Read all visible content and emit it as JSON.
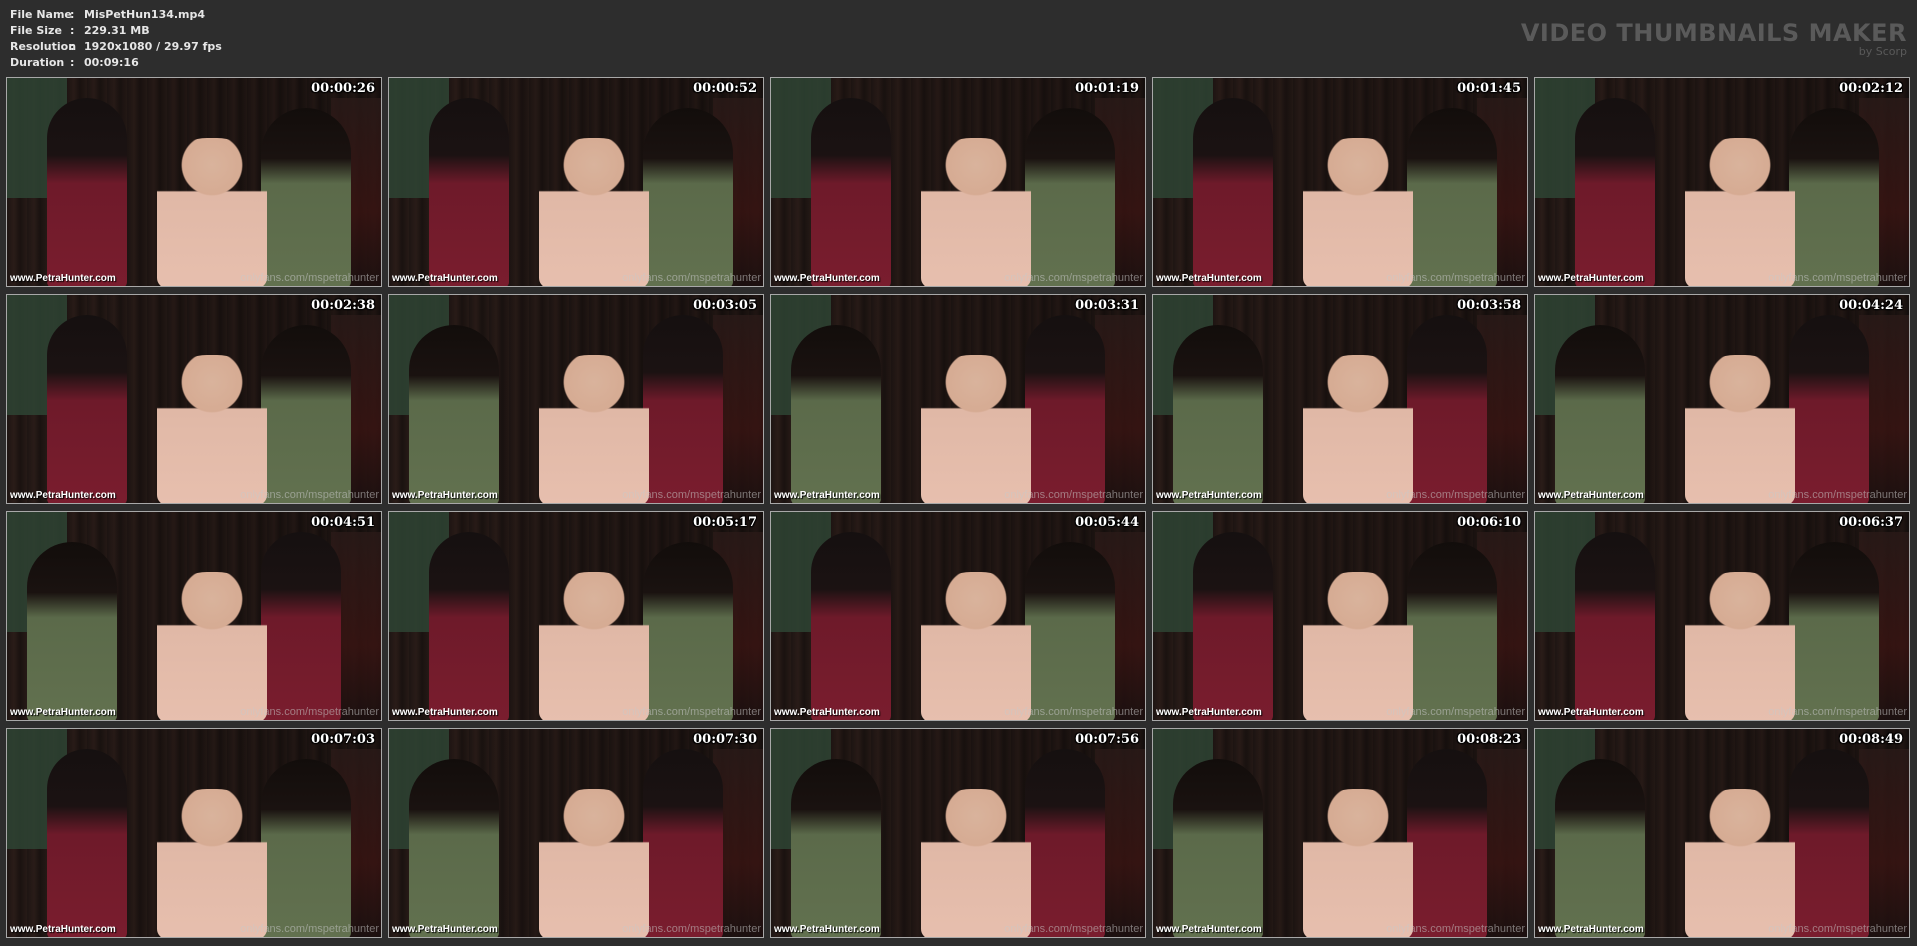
{
  "file_info": {
    "rows": [
      {
        "label": "File Name",
        "value": "MisPetHun134.mp4"
      },
      {
        "label": "File Size",
        "value": "229.31 MB"
      },
      {
        "label": "Resolution",
        "value": "1920x1080 / 29.97 fps"
      },
      {
        "label": "Duration",
        "value": "00:09:16"
      }
    ],
    "separator": ":"
  },
  "brand": {
    "title": "VIDEO THUMBNAILS MAKER",
    "subtitle": "by Scorp"
  },
  "watermarks": {
    "left": "www.PetraHunter.com",
    "right": "onlyfans.com/mspetrahunter"
  },
  "thumbnails": [
    {
      "timestamp": "00:00:26"
    },
    {
      "timestamp": "00:00:52"
    },
    {
      "timestamp": "00:01:19"
    },
    {
      "timestamp": "00:01:45"
    },
    {
      "timestamp": "00:02:12"
    },
    {
      "timestamp": "00:02:38"
    },
    {
      "timestamp": "00:03:05"
    },
    {
      "timestamp": "00:03:31"
    },
    {
      "timestamp": "00:03:58"
    },
    {
      "timestamp": "00:04:24"
    },
    {
      "timestamp": "00:04:51"
    },
    {
      "timestamp": "00:05:17"
    },
    {
      "timestamp": "00:05:44"
    },
    {
      "timestamp": "00:06:10"
    },
    {
      "timestamp": "00:06:37"
    },
    {
      "timestamp": "00:07:03"
    },
    {
      "timestamp": "00:07:30"
    },
    {
      "timestamp": "00:07:56"
    },
    {
      "timestamp": "00:08:23"
    },
    {
      "timestamp": "00:08:49"
    }
  ]
}
